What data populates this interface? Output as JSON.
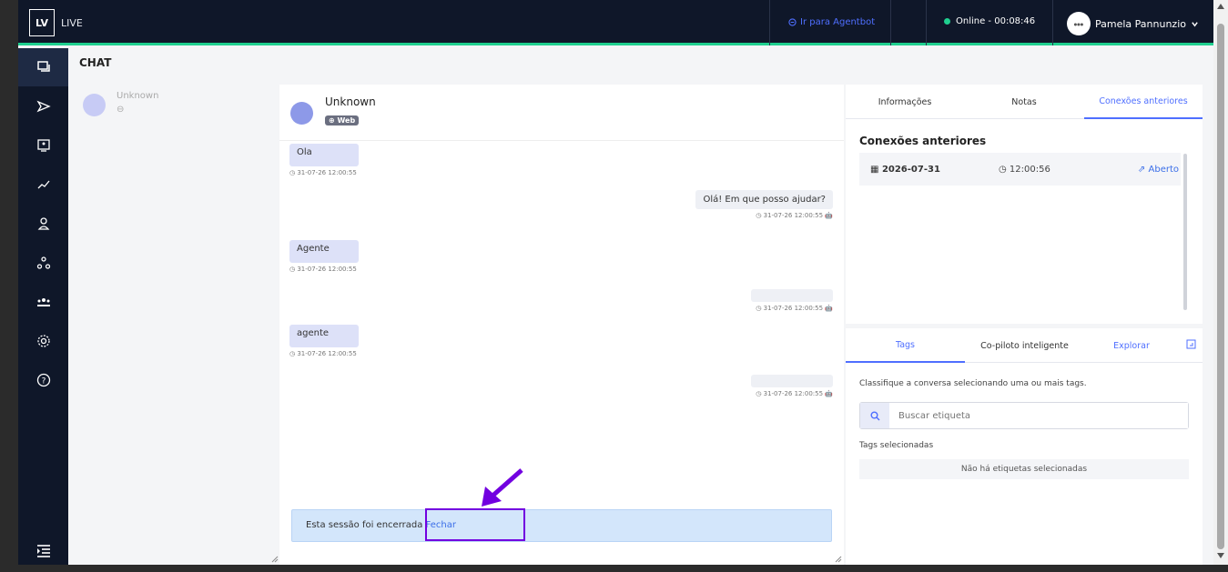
{
  "header": {
    "logo": "LV",
    "app_name": "LIVE",
    "agentbot_link": "Ir para Agentbot",
    "status": "Online - 00:08:46",
    "user_name": "Pamela Pannunzio",
    "accent": "#1fcf8f"
  },
  "page_title": "CHAT",
  "conversation_list": [
    {
      "name": "Unknown",
      "sub": "⊖"
    }
  ],
  "chat": {
    "contact_name": "Unknown",
    "channel_badge": "Web",
    "messages": [
      {
        "side": "left",
        "text": "Ola",
        "time": "31-07-26 12:00:55"
      },
      {
        "side": "right",
        "text": "Olá! Em que posso ajudar?",
        "time": "31-07-26 12:00:55"
      },
      {
        "side": "left",
        "text": "Agente",
        "time": "31-07-26 12:00:55"
      },
      {
        "side": "right",
        "text": "",
        "time": "31-07-26 12:00:55"
      },
      {
        "side": "left",
        "text": "agente",
        "time": "31-07-26 12:00:55"
      },
      {
        "side": "right",
        "text": "",
        "time": "31-07-26 12:00:55"
      }
    ],
    "banner_text": "Esta sessão foi encerrada",
    "banner_link": "Fechar",
    "highlight_color": "#7200e0"
  },
  "right_panel": {
    "tabs": [
      "Informações",
      "Notas",
      "Conexões anteriores"
    ],
    "active_tab": "Conexões anteriores",
    "section_title": "Conexões anteriores",
    "connections": [
      {
        "date": "2026-07-31",
        "time": "12:00:56",
        "status": "Aberto"
      }
    ],
    "bottom_tabs": [
      "Tags",
      "Co-piloto inteligente",
      "Explorar"
    ],
    "bottom_active": "Tags",
    "tags_description": "Classifique a conversa selecionando uma ou mais tags.",
    "search_placeholder": "Buscar etiqueta",
    "selected_label": "Tags selecionadas",
    "empty_text": "Não há etiquetas selecionadas"
  }
}
